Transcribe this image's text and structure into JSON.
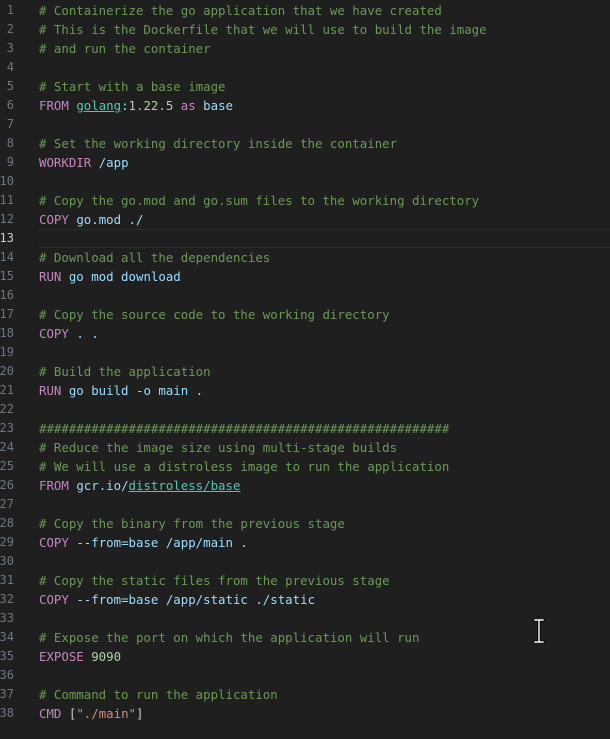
{
  "editor": {
    "active_line": 13,
    "lines": [
      {
        "n": "1",
        "tokens": [
          {
            "c": "c",
            "t": "# Containerize the go application that we have created"
          }
        ]
      },
      {
        "n": "2",
        "tokens": [
          {
            "c": "c",
            "t": "# This is the Dockerfile that we will use to build the image"
          }
        ]
      },
      {
        "n": "3",
        "tokens": [
          {
            "c": "c",
            "t": "# and run the container"
          }
        ]
      },
      {
        "n": "4",
        "tokens": []
      },
      {
        "n": "5",
        "tokens": [
          {
            "c": "c",
            "t": "# Start with a base image"
          }
        ]
      },
      {
        "n": "6",
        "tokens": [
          {
            "c": "k",
            "t": "FROM "
          },
          {
            "c": "l",
            "t": "golang"
          },
          {
            "c": "t",
            "t": ":"
          },
          {
            "c": "n",
            "t": "1.22.5"
          },
          {
            "c": "t",
            "t": " "
          },
          {
            "c": "k",
            "t": "as"
          },
          {
            "c": "t",
            "t": " base"
          }
        ]
      },
      {
        "n": "7",
        "tokens": []
      },
      {
        "n": "8",
        "tokens": [
          {
            "c": "c",
            "t": "# Set the working directory inside the container"
          }
        ]
      },
      {
        "n": "9",
        "tokens": [
          {
            "c": "k",
            "t": "WORKDIR "
          },
          {
            "c": "t",
            "t": "/app"
          }
        ]
      },
      {
        "n": "10",
        "tokens": []
      },
      {
        "n": "11",
        "tokens": [
          {
            "c": "c",
            "t": "# Copy the go.mod and go.sum files to the working directory"
          }
        ]
      },
      {
        "n": "12",
        "tokens": [
          {
            "c": "k",
            "t": "COPY "
          },
          {
            "c": "t",
            "t": "go.mod ./"
          }
        ]
      },
      {
        "n": "13",
        "tokens": []
      },
      {
        "n": "14",
        "tokens": [
          {
            "c": "c",
            "t": "# Download all the dependencies"
          }
        ]
      },
      {
        "n": "15",
        "tokens": [
          {
            "c": "k",
            "t": "RUN "
          },
          {
            "c": "t",
            "t": "go mod download"
          }
        ]
      },
      {
        "n": "16",
        "tokens": []
      },
      {
        "n": "17",
        "tokens": [
          {
            "c": "c",
            "t": "# Copy the source code to the working directory"
          }
        ]
      },
      {
        "n": "18",
        "tokens": [
          {
            "c": "k",
            "t": "COPY "
          },
          {
            "c": "t",
            "t": ". ."
          }
        ]
      },
      {
        "n": "19",
        "tokens": []
      },
      {
        "n": "20",
        "tokens": [
          {
            "c": "c",
            "t": "# Build the application"
          }
        ]
      },
      {
        "n": "21",
        "tokens": [
          {
            "c": "k",
            "t": "RUN "
          },
          {
            "c": "t",
            "t": "go build -o main ."
          }
        ]
      },
      {
        "n": "22",
        "tokens": []
      },
      {
        "n": "23",
        "tokens": [
          {
            "c": "c",
            "t": "#######################################################"
          }
        ]
      },
      {
        "n": "24",
        "tokens": [
          {
            "c": "c",
            "t": "# Reduce the image size using multi-stage builds"
          }
        ]
      },
      {
        "n": "25",
        "tokens": [
          {
            "c": "c",
            "t": "# We will use a distroless image to run the application"
          }
        ]
      },
      {
        "n": "26",
        "tokens": [
          {
            "c": "k",
            "t": "FROM "
          },
          {
            "c": "t",
            "t": "gcr.io/"
          },
          {
            "c": "l",
            "t": "distroless/base"
          }
        ]
      },
      {
        "n": "27",
        "tokens": []
      },
      {
        "n": "28",
        "tokens": [
          {
            "c": "c",
            "t": "# Copy the binary from the previous stage"
          }
        ]
      },
      {
        "n": "29",
        "tokens": [
          {
            "c": "k",
            "t": "COPY "
          },
          {
            "c": "t",
            "t": "--from=base /app/main ."
          }
        ]
      },
      {
        "n": "30",
        "tokens": []
      },
      {
        "n": "31",
        "tokens": [
          {
            "c": "c",
            "t": "# Copy the static files from the previous stage"
          }
        ]
      },
      {
        "n": "32",
        "tokens": [
          {
            "c": "k",
            "t": "COPY "
          },
          {
            "c": "t",
            "t": "--from=base /app/static ./static"
          }
        ]
      },
      {
        "n": "33",
        "tokens": []
      },
      {
        "n": "34",
        "tokens": [
          {
            "c": "c",
            "t": "# Expose the port on which the application will run"
          }
        ]
      },
      {
        "n": "35",
        "tokens": [
          {
            "c": "k",
            "t": "EXPOSE "
          },
          {
            "c": "n",
            "t": "9090"
          }
        ]
      },
      {
        "n": "36",
        "tokens": []
      },
      {
        "n": "37",
        "tokens": [
          {
            "c": "c",
            "t": "# Command to run the application"
          }
        ]
      },
      {
        "n": "38",
        "tokens": [
          {
            "c": "k",
            "t": "CMD "
          },
          {
            "c": "p",
            "t": "["
          },
          {
            "c": "s",
            "t": "\"./main\""
          },
          {
            "c": "p",
            "t": "]"
          }
        ]
      }
    ]
  },
  "colors": {
    "background": "#1f1f1f",
    "comment": "#6a9955",
    "keyword": "#c586c0",
    "text": "#9cdcfe",
    "number": "#b5cea8",
    "string": "#ce9178",
    "link": "#4ec9b0",
    "line_number": "#6e7681"
  },
  "cursor": {
    "icon": "text-ibeam-cursor-icon"
  }
}
